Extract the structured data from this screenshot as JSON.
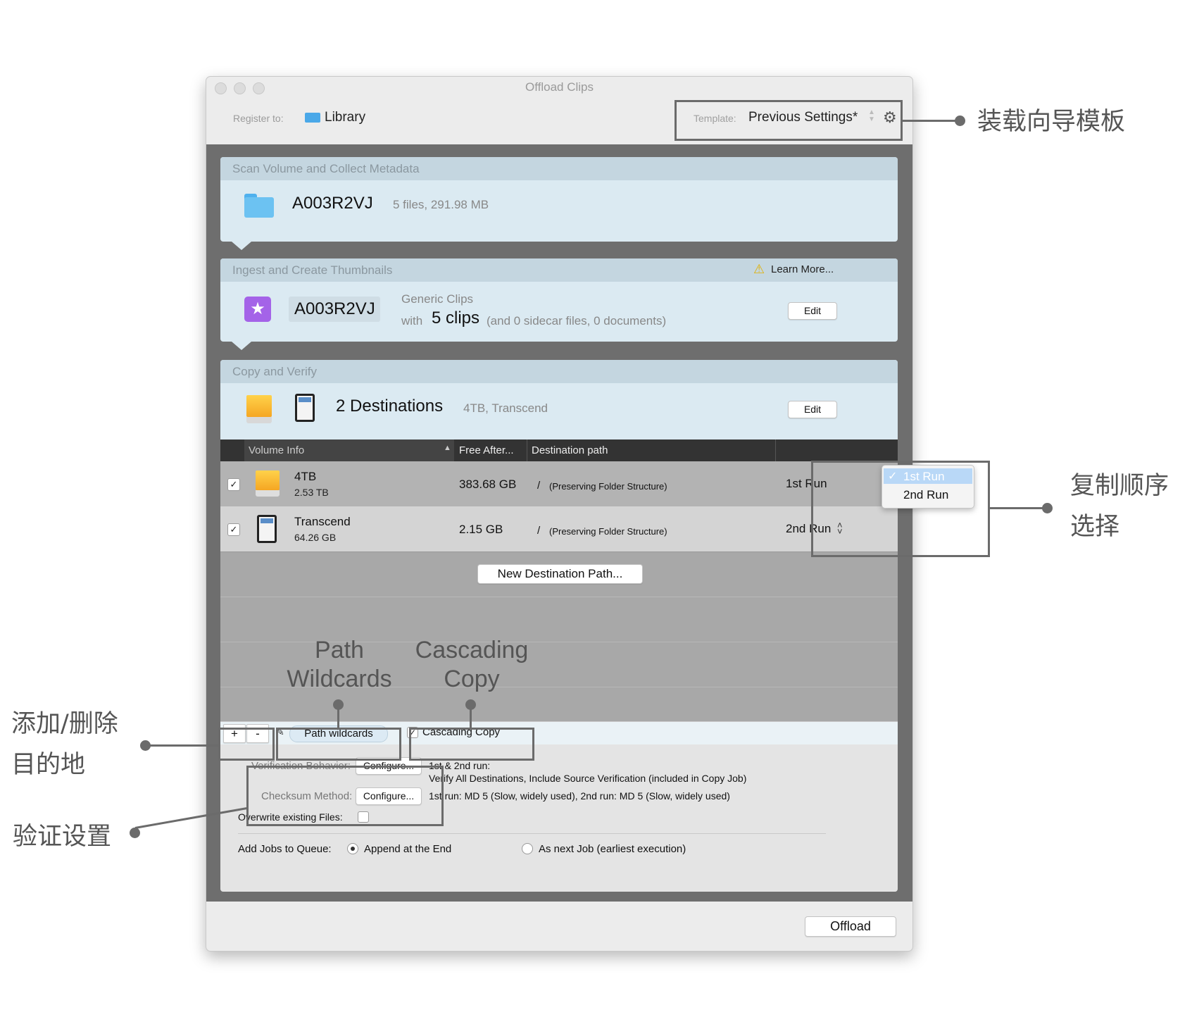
{
  "window": {
    "title": "Offload Clips"
  },
  "toolbar": {
    "register_label": "Register to:",
    "register_value": "Library",
    "template_label": "Template:",
    "template_value": "Previous Settings*"
  },
  "scan": {
    "header": "Scan Volume and Collect Metadata",
    "name": "A003R2VJ",
    "info": "5 files, 291.98 MB"
  },
  "ingest": {
    "header": "Ingest and Create Thumbnails",
    "learn_more": "Learn More...",
    "name": "A003R2VJ",
    "type": "Generic Clips",
    "with_label": "with",
    "clips": "5 clips",
    "details": "(and 0 sidecar files, 0 documents)",
    "edit_label": "Edit"
  },
  "copy": {
    "header": "Copy and Verify",
    "title": "2 Destinations",
    "info": "4TB, Transcend",
    "edit_label": "Edit",
    "columns": {
      "volume": "Volume Info",
      "free": "Free After...",
      "path": "Destination path"
    },
    "rows": [
      {
        "name": "4TB",
        "size": "2.53 TB",
        "free": "383.68 GB",
        "path_slash": "/",
        "path_note": "(Preserving Folder Structure)",
        "run": "1st Run"
      },
      {
        "name": "Transcend",
        "size": "64.26 GB",
        "free": "2.15 GB",
        "path_slash": "/",
        "path_note": "(Preserving Folder Structure)",
        "run": "2nd Run"
      }
    ],
    "run_menu": {
      "selected": "1st Run",
      "other": "2nd Run"
    },
    "new_destination_label": "New Destination Path...",
    "add_label": "+",
    "remove_label": "-",
    "path_wildcards_label": "Path wildcards",
    "cascading_label": "Cascading Copy",
    "verification_label": "Verification Behavior:",
    "checksum_label": "Checksum Method:",
    "configure_label": "Configure...",
    "verify_line1": "1st & 2nd run:",
    "verify_line2": "Verify All Destinations, Include Source Verification (included in Copy Job)",
    "checksum_text": "1st run: MD 5 (Slow, widely used), 2nd run: MD 5 (Slow, widely used)",
    "overwrite_label": "Overwrite existing Files:",
    "queue_label": "Add Jobs to Queue:",
    "queue_append": "Append at the End",
    "queue_next": "As next Job (earliest execution)"
  },
  "footer": {
    "offload_label": "Offload"
  },
  "annotations": {
    "template": "装载向导模板",
    "order_line1": "复制顺序",
    "order_line2": "选择",
    "add_remove_line1": "添加/删除",
    "add_remove_line2": "目的地",
    "verify": "验证设置",
    "path_wildcards_line1": "Path",
    "path_wildcards_line2": "Wildcards",
    "cascading_line1": "Cascading",
    "cascading_line2": "Copy"
  },
  "colors": {
    "panel": "#dbeaf2",
    "panel_header": "#c4d6e0",
    "dark_bg": "#6e6e6e",
    "table_header": "#333333",
    "drive_orange": "#f5a623",
    "folder_blue": "#6cc2f2",
    "star_purple": "#a463e8"
  }
}
